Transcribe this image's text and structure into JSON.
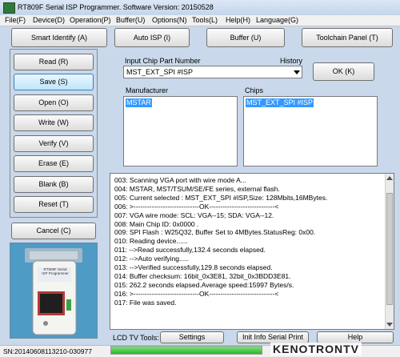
{
  "window": {
    "title": "RT809F Serial ISP Programmer. Software Version: 20150528"
  },
  "menu": [
    "File(F)",
    "Device(D)",
    "Operation(P)",
    "Buffer(U)",
    "Options(N)",
    "Tools(L)",
    "Help(H)",
    "Language(G)"
  ],
  "toolbar": {
    "smart_identify": "Smart Identify (A)",
    "auto_isp": "Auto ISP (I)",
    "buffer": "Buffer (U)",
    "toolchain": "Toolchain Panel (T)"
  },
  "side": {
    "read": "Read (R)",
    "save": "Save (S)",
    "open": "Open (O)",
    "write": "Write  (W)",
    "verify": "Verify (V)",
    "erase": "Erase (E)",
    "blank": "Blank (B)",
    "reset": "Reset  (T)",
    "cancel": "Cancel (C)"
  },
  "chip_input": {
    "label": "Input Chip Part Number",
    "history": "History",
    "value": "MST_EXT_SPI #ISP",
    "ok": "OK (K)"
  },
  "manufacturer": {
    "label": "Manufacturer",
    "selected": "MSTAR"
  },
  "chips": {
    "label": "Chips",
    "selected": "MST_EXT_SPI #ISP"
  },
  "log": [
    "003:  Scanning VGA port with wire mode A...",
    "004:  MSTAR, MST/TSUM/SE/FE series, external flash.",
    "005:  Current selected : MST_EXT_SPI #ISP,Size: 128Mbits,16MBytes.",
    "006:  >-----------------------------OK-----------------------------<",
    "007:  VGA wire mode: SCL: VGA--15; SDA: VGA--12.",
    "008:  Main Chip ID: 0x0000 .",
    "009:  SPI Flash : W25Q32, Buffer Set to 4MBytes.StatusReg: 0x00.",
    "010:  Reading device......",
    "011:  -->Read successfully,132.4 seconds elapsed.",
    "012:  -->Auto verifying.....",
    "013:  -->Verified successfully,129.8 seconds elapsed.",
    "014:  Buffer checksum: 16bit_0x3E81, 32bit_0x3BDD3E81.",
    "015:  262.2 seconds elapsed.Average speed:15997 Bytes/s.",
    "016:  >-----------------------------OK-----------------------------<",
    "017:  File was saved."
  ],
  "bottom": {
    "lcd_label": "LCD TV Tools:",
    "settings": "Settings",
    "init_serial": "Init Info Serial Print",
    "help": "Help"
  },
  "status": {
    "serial": "SN:20140608113210-030977",
    "progress": 1.0
  },
  "watermark": "KENOTRONTV",
  "device_image": {
    "text": "RT809F Serial ISP Programmer"
  }
}
